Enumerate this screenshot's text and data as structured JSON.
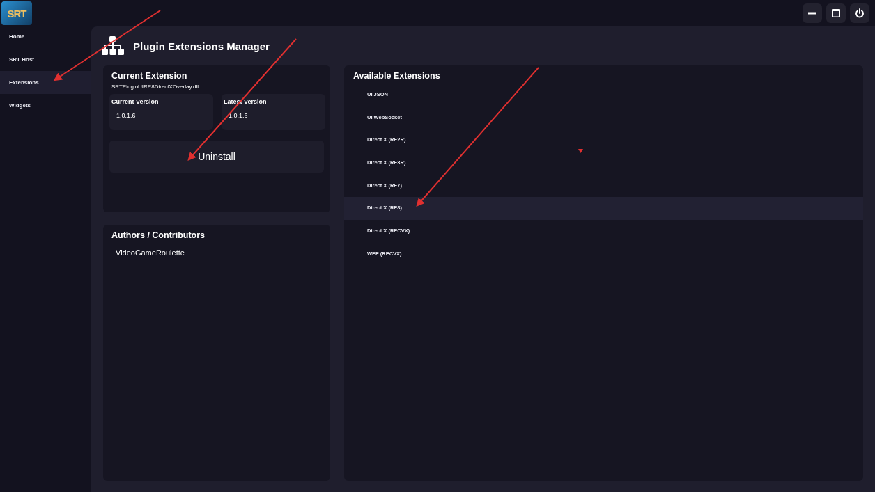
{
  "app": {
    "logo": "SRT"
  },
  "sidebar": {
    "items": [
      {
        "label": "Home",
        "selected": false
      },
      {
        "label": "SRT Host",
        "selected": false
      },
      {
        "label": "Extensions",
        "selected": true
      },
      {
        "label": "Widgets",
        "selected": false
      }
    ]
  },
  "page": {
    "title": "Plugin Extensions Manager"
  },
  "current_extension": {
    "title": "Current Extension",
    "file": "SRTPluginUIRE8DirectXOverlay.dll",
    "versions": [
      {
        "label": "Current Version",
        "value": "1.0.1.6"
      },
      {
        "label": "Latest Version",
        "value": "1.0.1.6"
      }
    ],
    "action": "Uninstall"
  },
  "authors": {
    "title": "Authors / Contributors",
    "names": [
      "VideoGameRoulette"
    ]
  },
  "available_extensions": {
    "title": "Available Extensions",
    "items": [
      {
        "label": "UI JSON",
        "selected": false
      },
      {
        "label": "UI WebSocket",
        "selected": false
      },
      {
        "label": "Direct X (RE2R)",
        "selected": false
      },
      {
        "label": "Direct X (RE3R)",
        "selected": false
      },
      {
        "label": "Direct X (RE7)",
        "selected": false
      },
      {
        "label": "Direct X (RE8)",
        "selected": true
      },
      {
        "label": "Direct X (RECVX)",
        "selected": false
      },
      {
        "label": "WPF (RECVX)",
        "selected": false
      }
    ]
  }
}
